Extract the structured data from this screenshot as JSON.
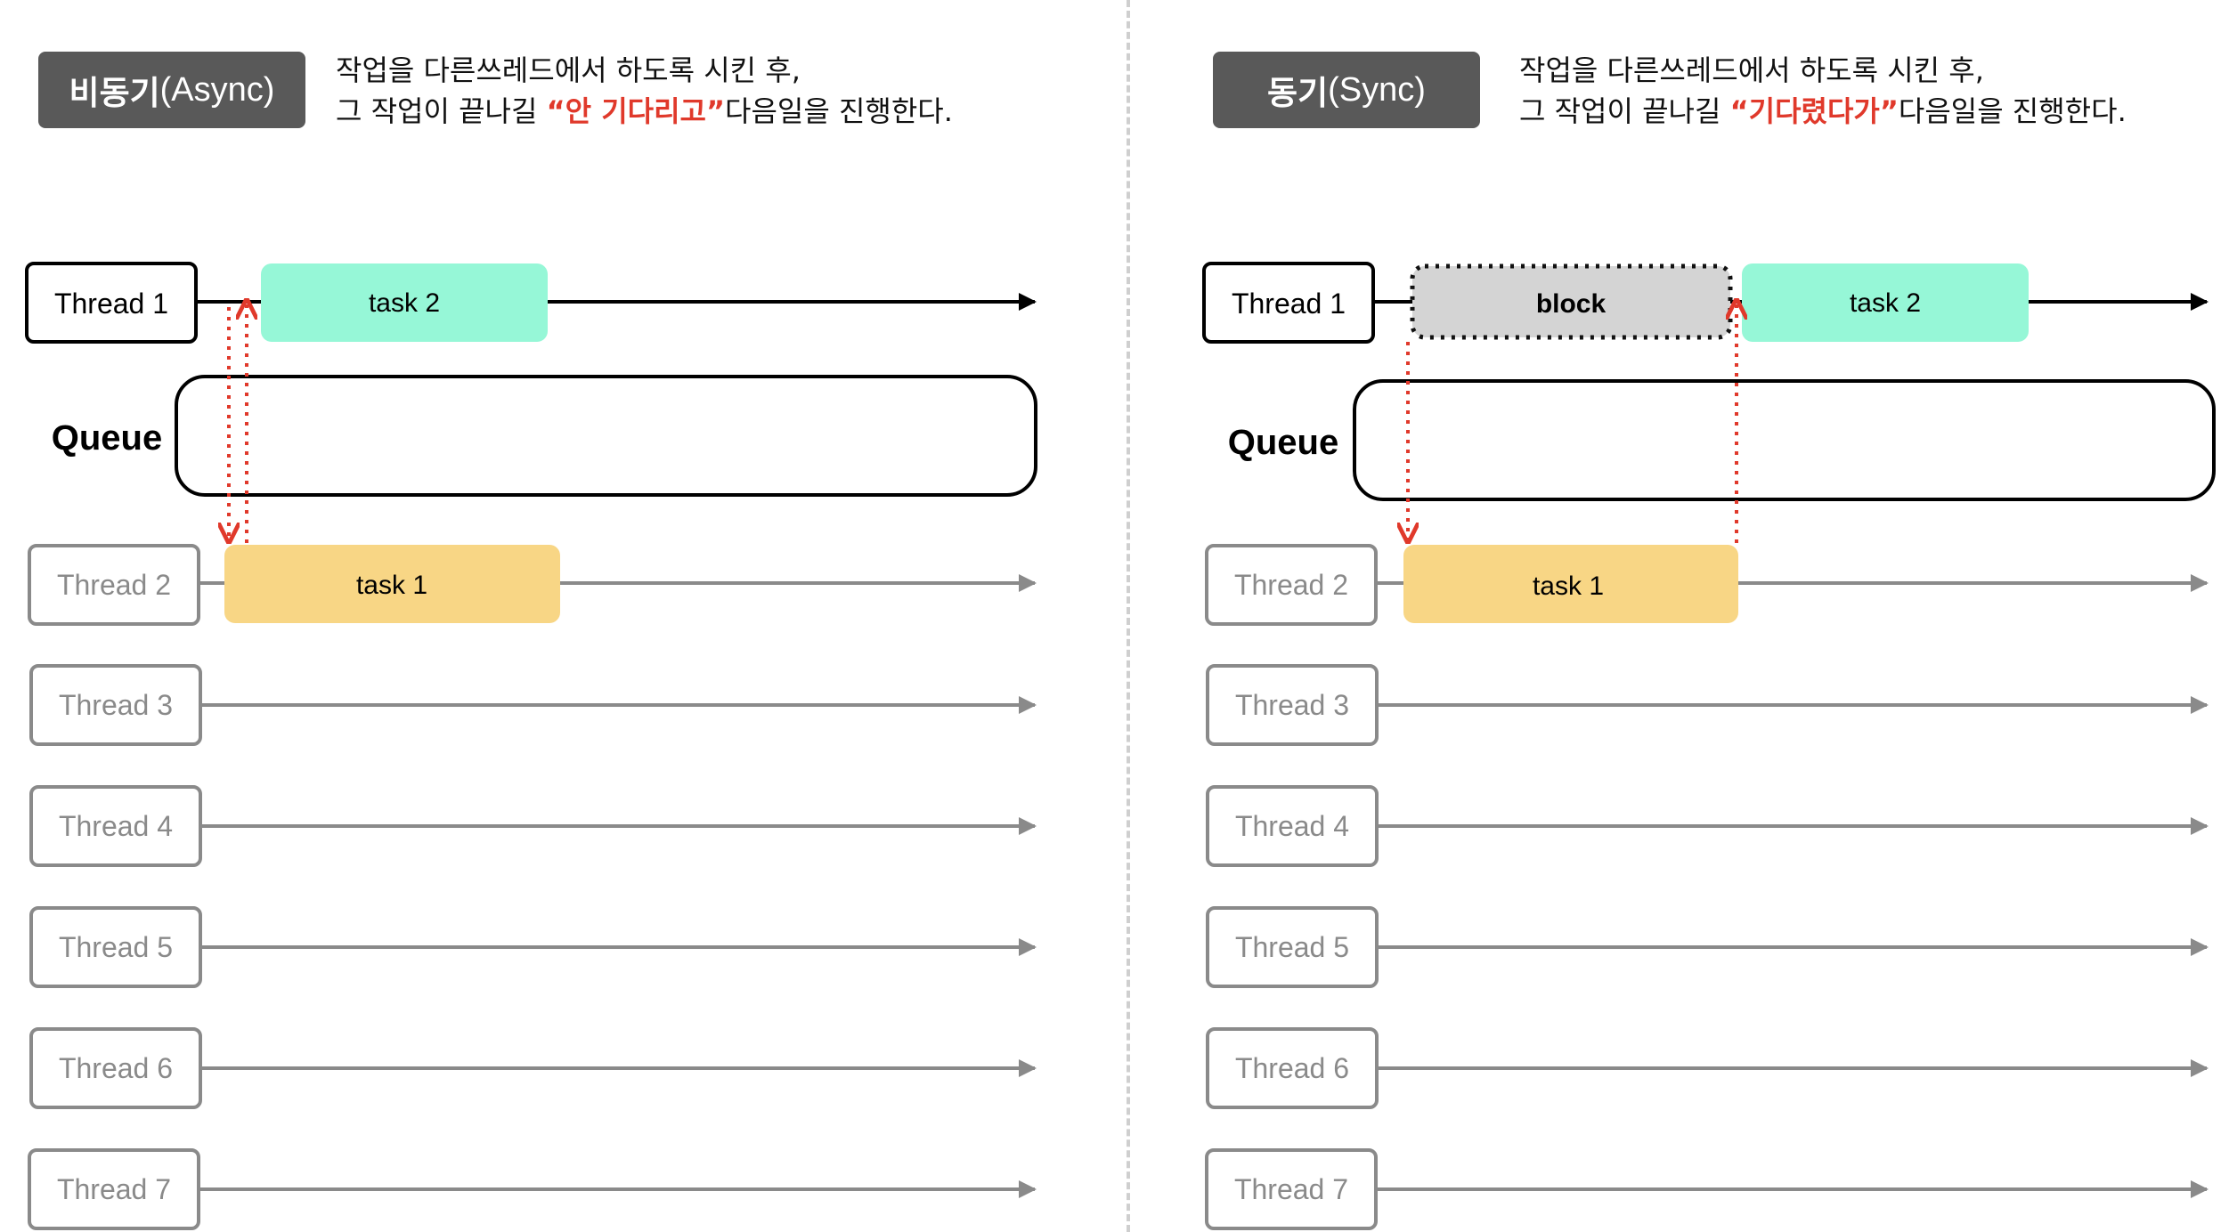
{
  "async": {
    "badge_kr": "비동기",
    "badge_en": "(Async)",
    "desc_line1": "작업을 다른쓰레드에서 하도록 시킨 후,",
    "desc_line2_pre": "그 작업이 끝나길 ",
    "desc_line2_em": "“안 기다리고”",
    "desc_line2_post": "다음일을 진행한다.",
    "task2": "task 2",
    "task1": "task 1",
    "queue": "Queue"
  },
  "sync": {
    "badge_kr": "동기",
    "badge_en": "(Sync)",
    "desc_line1": "작업을 다른쓰레드에서 하도록 시킨 후,",
    "desc_line2_pre": "그 작업이 끝나길 ",
    "desc_line2_em": "“기다렸다가”",
    "desc_line2_post": "다음일을 진행한다.",
    "block": "block",
    "task2": "task 2",
    "task1": "task 1",
    "queue": "Queue"
  },
  "threads": [
    "Thread 1",
    "Thread 2",
    "Thread 3",
    "Thread 4",
    "Thread 5",
    "Thread 6",
    "Thread 7"
  ],
  "colors": {
    "task2": "#96f7d7",
    "task1": "#f8d685",
    "block": "#d4d4d4",
    "arrow_red": "#e0392b",
    "badge": "#595959",
    "inactive": "#8a8a8a"
  }
}
